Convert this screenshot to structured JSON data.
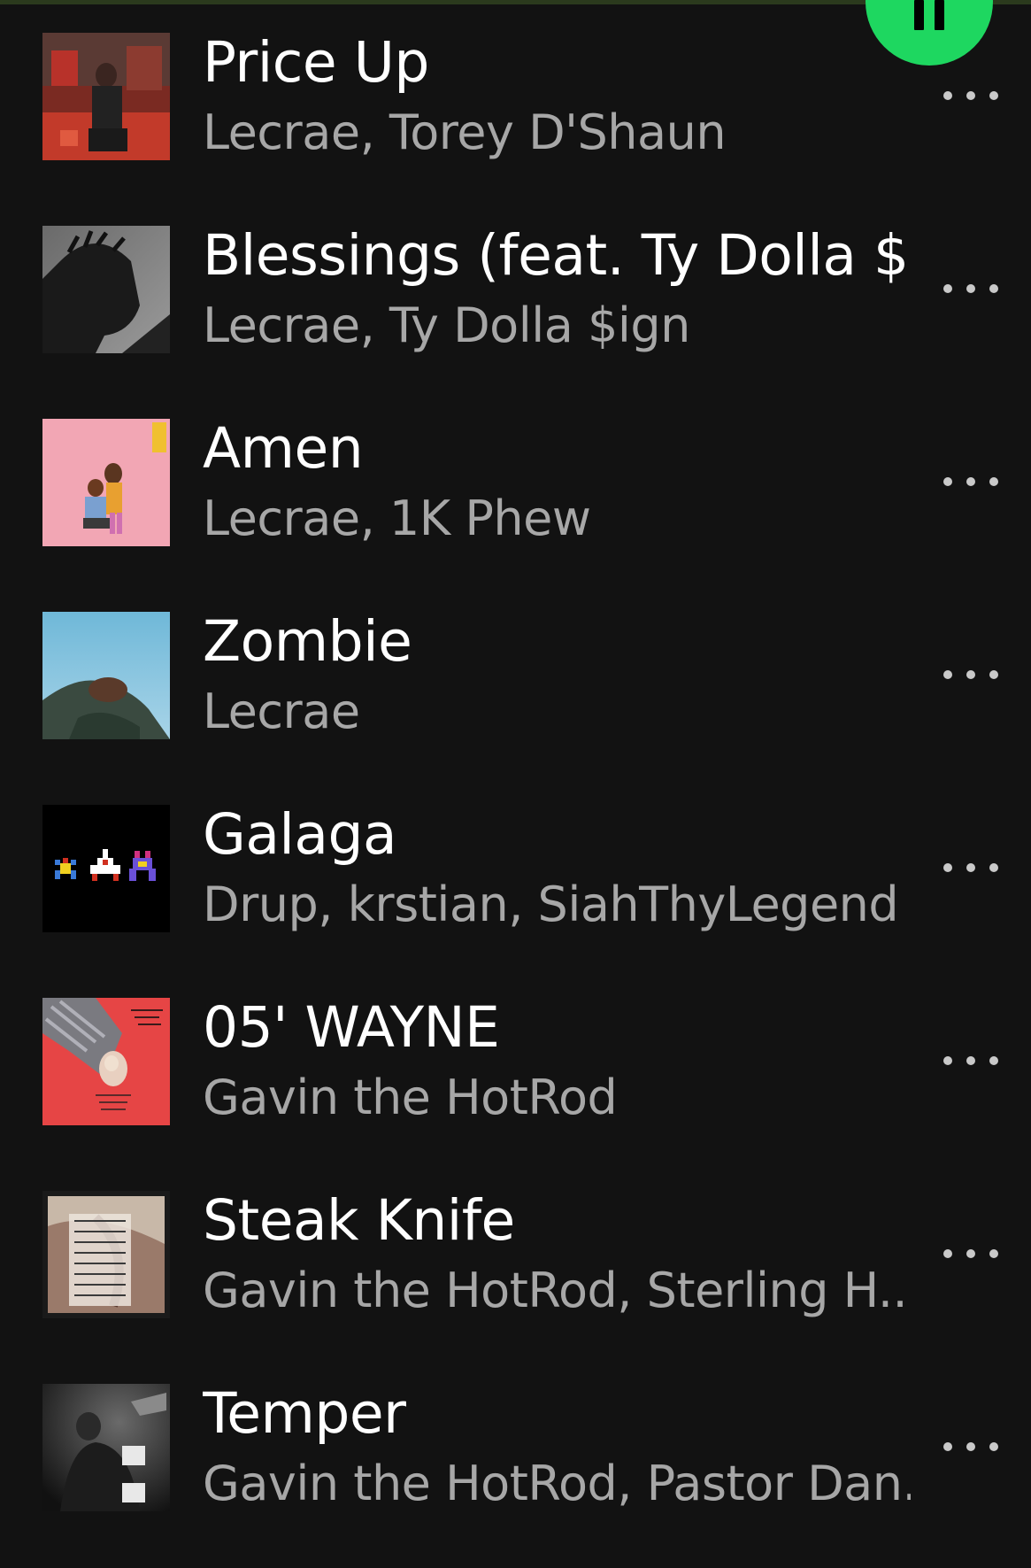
{
  "colors": {
    "background": "#121212",
    "accent": "#1ed760",
    "primary_text": "#ffffff",
    "secondary_text": "#a7a7a7"
  },
  "player": {
    "play_button_icon": "pause-icon"
  },
  "tracks": [
    {
      "title": "Price Up",
      "artists": "Lecrae, Torey D'Shaun",
      "more_icon": "more-options-icon"
    },
    {
      "title": "Blessings (feat. Ty Dolla $...",
      "artists": "Lecrae, Ty Dolla $ign",
      "more_icon": "more-options-icon"
    },
    {
      "title": "Amen",
      "artists": "Lecrae, 1K Phew",
      "more_icon": "more-options-icon"
    },
    {
      "title": "Zombie",
      "artists": "Lecrae",
      "more_icon": "more-options-icon"
    },
    {
      "title": "Galaga",
      "artists": "Drup, krstian, SiahThyLegend",
      "more_icon": "more-options-icon"
    },
    {
      "title": "05' WAYNE",
      "artists": "Gavin the HotRod",
      "more_icon": "more-options-icon"
    },
    {
      "title": "Steak Knife",
      "artists": "Gavin the HotRod, Sterling H...",
      "more_icon": "more-options-icon"
    },
    {
      "title": "Temper",
      "artists": "Gavin the HotRod, Pastor Dan...",
      "more_icon": "more-options-icon"
    }
  ]
}
